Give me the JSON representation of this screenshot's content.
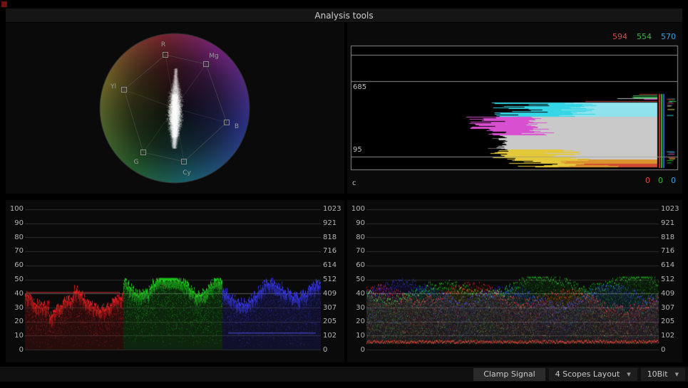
{
  "title": "Analysis tools",
  "vectorscope": {
    "targets": [
      {
        "label": "R"
      },
      {
        "label": "Mg"
      },
      {
        "label": "B"
      },
      {
        "label": "Cy"
      },
      {
        "label": "G"
      },
      {
        "label": "Yl"
      }
    ]
  },
  "histogram": {
    "top_values": [
      "594",
      "554",
      "570"
    ],
    "ref_high": "685",
    "ref_low": "95",
    "corner_label": "c",
    "bottom_values": [
      "0",
      "0",
      "0"
    ]
  },
  "scales": {
    "percent": [
      "100",
      "90",
      "80",
      "70",
      "60",
      "50",
      "40",
      "30",
      "20",
      "10",
      "0"
    ],
    "code": [
      "1023",
      "921",
      "818",
      "716",
      "614",
      "512",
      "409",
      "307",
      "205",
      "102",
      "0"
    ]
  },
  "controls": {
    "clamp_signal": "Clamp Signal",
    "layout_selector": "4 Scopes Layout",
    "bit_depth": "10Bit",
    "dropdown_arrow": "▼"
  },
  "colors": {
    "red_text": "#d84848",
    "green_text": "#3db53d",
    "blue_text": "#419fd9"
  }
}
